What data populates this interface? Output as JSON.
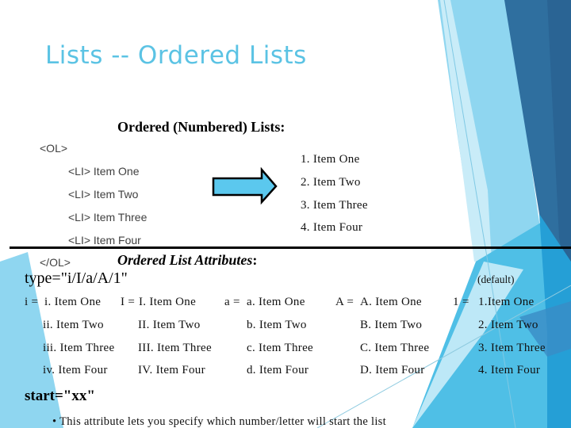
{
  "slide": {
    "title": "Lists -- Ordered Lists",
    "section_heading": "Ordered (Numbered) Lists:",
    "code_example": {
      "open_tag": "<OL>",
      "items": [
        "<LI> Item One",
        "<LI> Item Two",
        "<LI> Item Three",
        "<LI> Item Four"
      ],
      "close_tag": "</OL>"
    },
    "arrow_icon": "right-arrow-icon",
    "rendered_list": [
      "1. Item One",
      "2. Item Two",
      "3. Item Three",
      "4. Item Four"
    ],
    "attributes_heading": "Ordered List Attributes",
    "attributes_heading_colon": ":",
    "type_attribute": "type=\"i/I/a/A/1\"",
    "default_note": "(default)",
    "type_columns": [
      {
        "label": "i =",
        "items": [
          "i. Item One",
          "ii. Item Two",
          "iii. Item Three",
          "iv. Item Four"
        ]
      },
      {
        "label": "I =",
        "items": [
          "I. Item One",
          "II. Item Two",
          "III. Item Three",
          "IV. Item Four"
        ]
      },
      {
        "label": "a =",
        "items": [
          "a. Item One",
          "b. Item Two",
          "c. Item Three",
          "d. Item Four"
        ]
      },
      {
        "label": "A =",
        "items": [
          "A. Item One",
          "B. Item Two",
          "C. Item Three",
          "D. Item Four"
        ]
      },
      {
        "label": "1 =",
        "items": [
          "1.Item One",
          "2. Item Two",
          "3. Item Three",
          "4. Item Four"
        ]
      }
    ],
    "start_attribute": "start=\"xx\"",
    "start_description": "• This attribute lets you specify which number/letter will start the list"
  },
  "colors": {
    "title": "#5bc3e4",
    "arrow_fill": "#5bc8ee",
    "accent_light": "#8fd6f0",
    "accent_mid": "#4fbfe6",
    "accent_dark": "#2f6f9f",
    "accent_darker": "#2a6494"
  }
}
